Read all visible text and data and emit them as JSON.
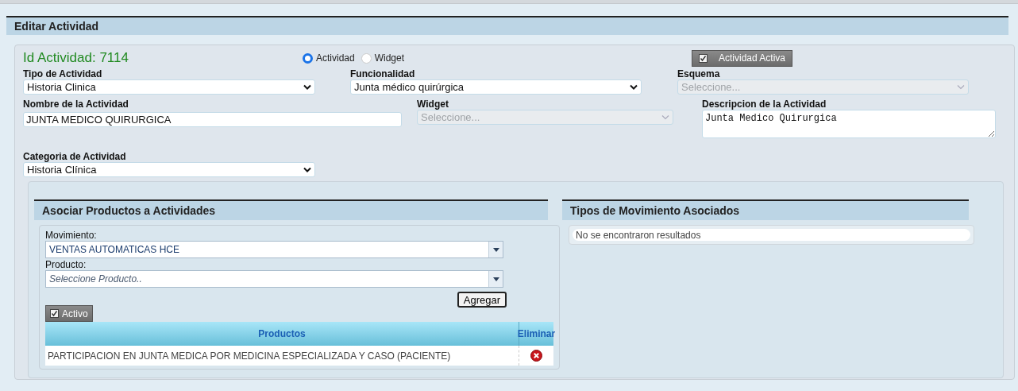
{
  "title": "Editar Actividad",
  "id_label": "Id Actividad: 7114",
  "mode_options": [
    {
      "label": "Actividad",
      "selected": true
    },
    {
      "label": "Widget",
      "selected": false
    }
  ],
  "active_toggle": {
    "label": "Actividad Activa",
    "checked": true
  },
  "rows": [
    [
      {
        "kind": "select",
        "label": "Tipo de Actividad",
        "value": "Historia Clinica",
        "disabled": false
      },
      {
        "kind": "select",
        "label": "Funcionalidad",
        "value": "Junta médico quirúrgica",
        "disabled": false
      },
      {
        "kind": "select",
        "label": "Esquema",
        "placeholder": "Seleccione...",
        "disabled": true
      }
    ],
    [
      {
        "kind": "input",
        "label": "Nombre de la Actividad",
        "value": "JUNTA MEDICO QUIRURGICA",
        "disabled": false
      },
      {
        "kind": "select",
        "label": "Widget",
        "placeholder": "Seleccione...",
        "disabled": true
      },
      {
        "kind": "textarea",
        "label": "Descripcion de la Actividad",
        "value": "Junta Medico Quirurgica",
        "disabled": false
      }
    ],
    [
      {
        "kind": "select",
        "label": "Categoria de Actividad",
        "value": "Historia Clínica",
        "disabled": false
      }
    ]
  ],
  "products": {
    "title": "Asociar Productos a Actividades",
    "movimiento": {
      "label": "Movimiento:",
      "value": "VENTAS AUTOMATICAS HCE"
    },
    "producto": {
      "label": "Producto:",
      "placeholder": "Seleccione Producto.."
    },
    "add_button": "Agregar",
    "active_toggle": {
      "label": "Activo",
      "checked": true
    },
    "table": {
      "columns": [
        "Productos",
        "Eliminar"
      ],
      "rows": [
        {
          "product": "PARTICIPACION EN JUNTA MEDICA POR MEDICINA ESPECIALIZADA Y CASO (PACIENTE)"
        }
      ]
    }
  },
  "movements": {
    "title": "Tipos de Movimiento Asociados",
    "empty_message": "No se encontraron resultados"
  }
}
